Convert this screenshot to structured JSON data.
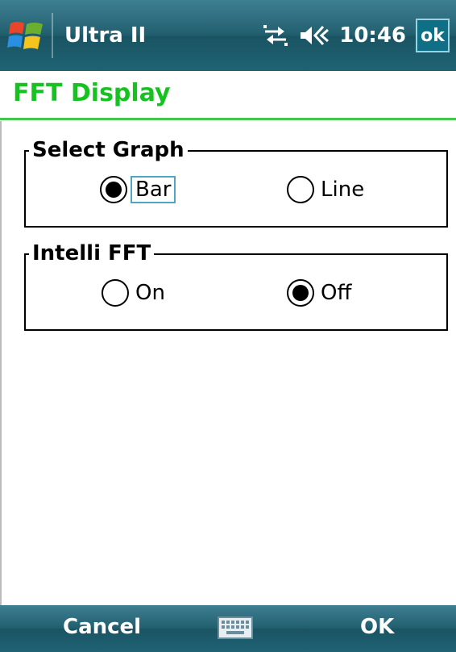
{
  "titlebar": {
    "app_title": "Ultra II",
    "time": "10:46",
    "ok_label": "ok",
    "icons": [
      "windows-start-icon",
      "connectivity-icon",
      "volume-icon"
    ]
  },
  "page": {
    "title": "FFT Display"
  },
  "groups": [
    {
      "legend": "Select Graph",
      "options": [
        {
          "label": "Bar",
          "selected": true,
          "focused": true
        },
        {
          "label": "Line",
          "selected": false
        }
      ]
    },
    {
      "legend": "Intelli FFT",
      "options": [
        {
          "label": "On",
          "selected": false
        },
        {
          "label": "Off",
          "selected": true
        }
      ]
    }
  ],
  "softkeys": {
    "left": "Cancel",
    "right": "OK",
    "center_icon": "keyboard-icon"
  },
  "colors": {
    "title_green": "#16c21f",
    "bar_teal": "#1f6374",
    "focus_blue": "#4fa6c2"
  }
}
